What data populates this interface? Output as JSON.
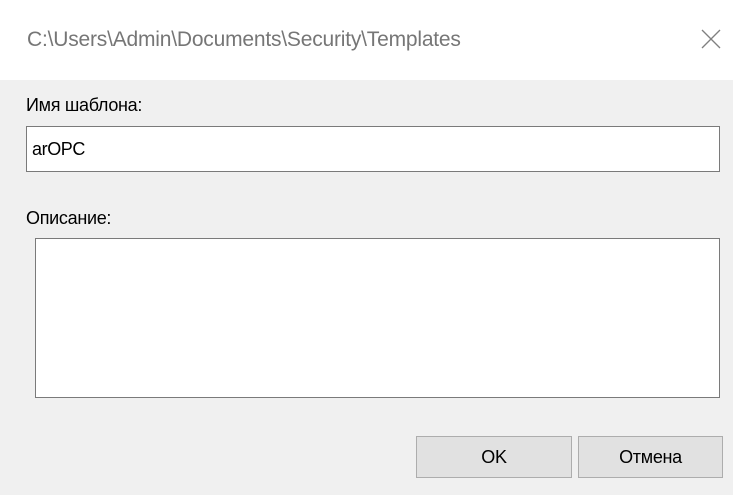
{
  "window": {
    "title": "C:\\Users\\Admin\\Documents\\Security\\Templates",
    "close_icon": "close-icon"
  },
  "form": {
    "name_label": "Имя шаблона:",
    "name_value": "arOPC",
    "description_label": "Описание:",
    "description_value": ""
  },
  "buttons": {
    "ok_label": "OK",
    "cancel_label": "Отмена"
  },
  "colors": {
    "titlebar_bg": "#ffffff",
    "dialog_bg": "#f0f0f0",
    "button_bg": "#e1e1e1",
    "input_border": "#7a7a7a"
  }
}
